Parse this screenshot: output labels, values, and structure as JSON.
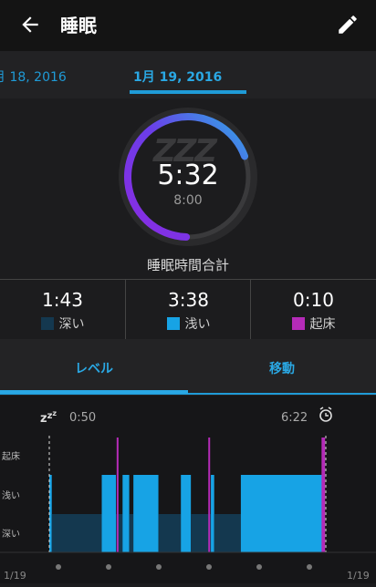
{
  "header": {
    "title": "睡眠"
  },
  "dates": {
    "previous": "月 18, 2016",
    "current": "1月 19, 2016"
  },
  "summary": {
    "total": "5:32",
    "goal": "8:00",
    "label": "睡眠時間合計",
    "progress_fraction": 0.69
  },
  "stats": [
    {
      "value": "1:43",
      "label": "深い",
      "color": "#14384f"
    },
    {
      "value": "3:38",
      "label": "浅い",
      "color": "#17a3e5"
    },
    {
      "value": "0:10",
      "label": "起床",
      "color": "#b52bb8"
    }
  ],
  "tabs": [
    {
      "label": "レベル"
    },
    {
      "label": "移動"
    }
  ],
  "timeline": {
    "start": "0:50",
    "end": "6:22",
    "left_date": "1/19",
    "right_date": "1/19"
  },
  "chart_data": {
    "type": "area",
    "title": "",
    "levels": [
      "起床",
      "浅い",
      "深い"
    ],
    "x_start": "0:50",
    "x_end": "6:22",
    "segments": [
      {
        "level": "浅い",
        "start": "0:50",
        "end": "0:53"
      },
      {
        "level": "深い",
        "start": "0:53",
        "end": "1:53"
      },
      {
        "level": "浅い",
        "start": "1:53",
        "end": "2:10"
      },
      {
        "level": "深い",
        "start": "2:10",
        "end": "2:18"
      },
      {
        "level": "浅い",
        "start": "2:18",
        "end": "2:26"
      },
      {
        "level": "深い",
        "start": "2:26",
        "end": "2:31"
      },
      {
        "level": "浅い",
        "start": "2:31",
        "end": "3:01"
      },
      {
        "level": "深い",
        "start": "3:01",
        "end": "3:28"
      },
      {
        "level": "浅い",
        "start": "3:28",
        "end": "3:40"
      },
      {
        "level": "深い",
        "start": "3:40",
        "end": "4:04"
      },
      {
        "level": "浅い",
        "start": "4:04",
        "end": "4:08"
      },
      {
        "level": "深い",
        "start": "4:08",
        "end": "4:40"
      },
      {
        "level": "浅い",
        "start": "4:40",
        "end": "6:20"
      }
    ],
    "awake_marks": [
      "2:12",
      "4:02",
      "6:18",
      "6:19",
      "6:20"
    ],
    "colors": {
      "起床": "#b52bb8",
      "浅い": "#17a3e5",
      "深い": "#14384f"
    }
  }
}
